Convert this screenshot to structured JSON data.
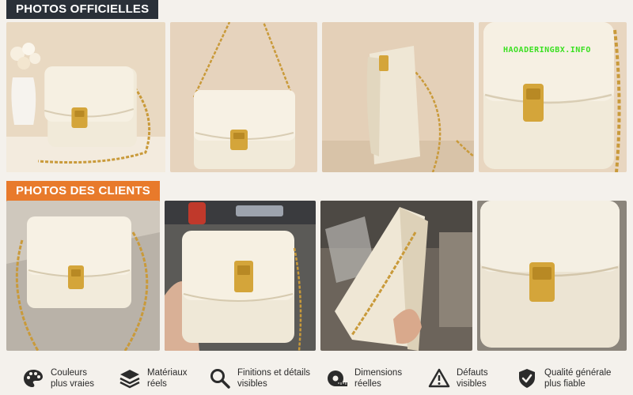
{
  "sections": {
    "official": "PHOTOS OFFICIELLES",
    "clients": "PHOTOS DES CLIENTS"
  },
  "watermark": "HAOADERINGBX.INFO",
  "features": [
    {
      "icon": "palette-icon",
      "label": "Couleurs\nplus vraies"
    },
    {
      "icon": "layers-icon",
      "label": "Matériaux\nréels"
    },
    {
      "icon": "magnifier-icon",
      "label": "Finitions et détails\nvisibles"
    },
    {
      "icon": "tape-measure-icon",
      "label": "Dimensions\nréelles"
    },
    {
      "icon": "warning-icon",
      "label": "Défauts\nvisibles"
    },
    {
      "icon": "shield-check-icon",
      "label": "Qualité générale\nplus fiable"
    }
  ],
  "colors": {
    "official_tag": "#2a3038",
    "clients_tag": "#e87a2b",
    "bag_cream": "#f1ead9",
    "chain_gold": "#c99a3a"
  }
}
